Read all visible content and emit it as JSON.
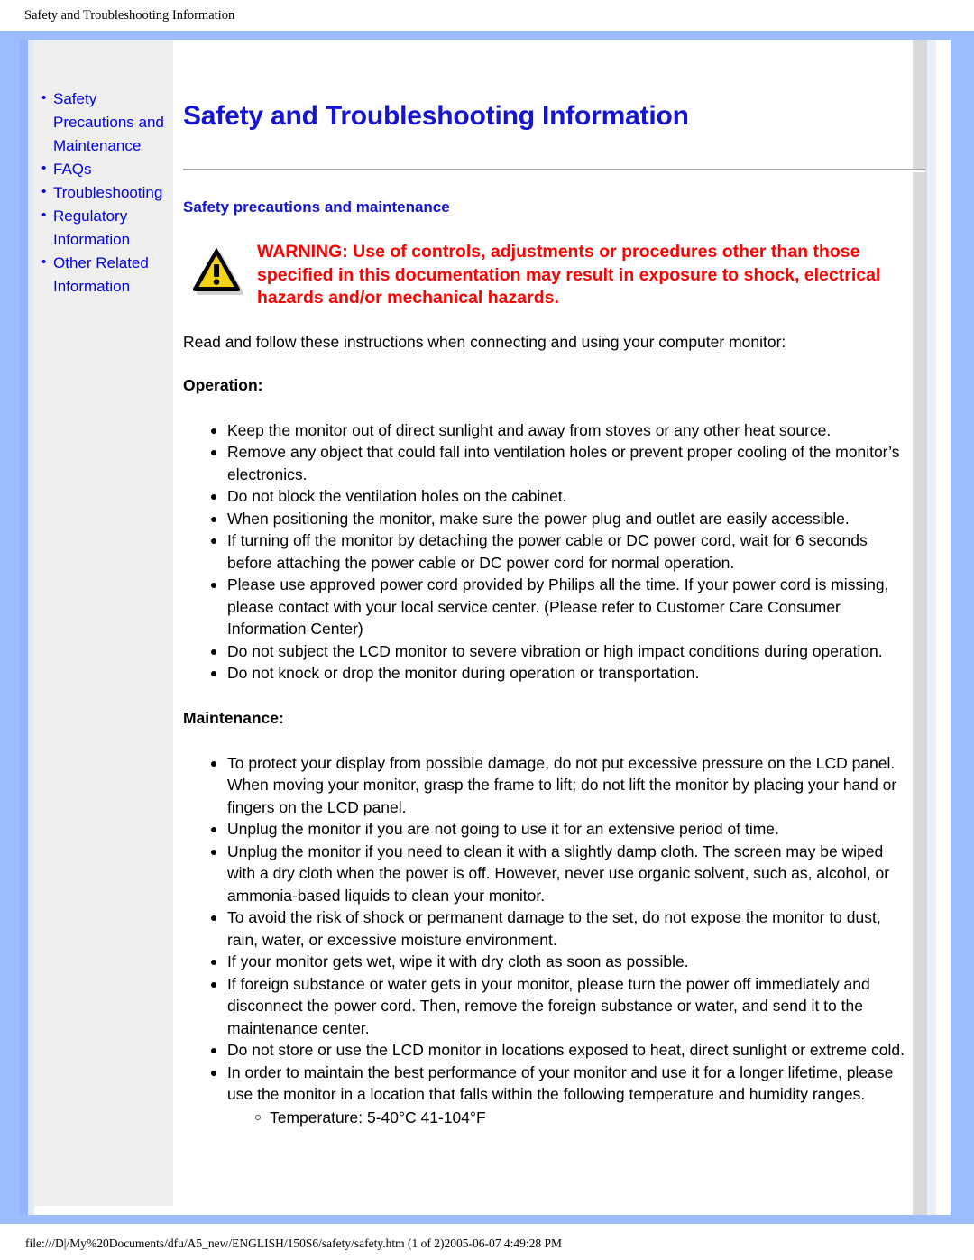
{
  "print_header": "Safety and Troubleshooting Information",
  "print_footer": "file:///D|/My%20Documents/dfu/A5_new/ENGLISH/150S6/safety/safety.htm (1 of 2)2005-06-07 4:49:28 PM",
  "colors": {
    "page_border": "#9dbcfb",
    "sidebar_bg": "#efefef",
    "link_blue": "#0000ee",
    "heading_blue": "#1414d2",
    "warning_red": "#ff0000",
    "warning_icon_fill": "#f5d312",
    "warning_icon_stroke": "#000000"
  },
  "sidebar": {
    "items": [
      {
        "label": "Safety Precautions and Maintenance"
      },
      {
        "label": "FAQs"
      },
      {
        "label": "Troubleshooting"
      },
      {
        "label": "Regulatory Information"
      },
      {
        "label": "Other Related Information"
      }
    ]
  },
  "main": {
    "title": "Safety and Troubleshooting Information",
    "section_heading": "Safety precautions and maintenance",
    "warning_icon_name": "warning-triangle-icon",
    "warning_text": "WARNING: Use of controls, adjustments or procedures other than those specified in this documentation may result in exposure to shock, electrical hazards and/or mechanical hazards.",
    "intro_paragraph": "Read and follow these instructions when connecting and using your computer monitor:",
    "operation": {
      "heading": "Operation:",
      "items": [
        "Keep the monitor out of direct sunlight and away from stoves or any other heat source.",
        "Remove any object that could fall into ventilation holes or prevent proper cooling of the monitor’s electronics.",
        "Do not block the ventilation holes on the cabinet.",
        "When positioning the monitor, make sure the power plug and outlet are easily accessible.",
        "If turning off the monitor by detaching the power cable or DC power cord, wait for 6 seconds before attaching the power cable or DC power cord for normal operation.",
        "Please use approved power cord provided by Philips all the time. If your power cord is missing, please contact with your local service center. (Please refer to Customer Care Consumer Information Center)",
        "Do not subject the LCD monitor to severe vibration or high impact conditions during operation.",
        "Do not knock or drop the monitor during operation or transportation."
      ]
    },
    "maintenance": {
      "heading": "Maintenance:",
      "items": [
        "To protect your display from possible damage, do not put excessive pressure on the LCD panel. When moving your monitor, grasp the frame to lift; do not lift the monitor by placing your hand or fingers on the LCD panel.",
        "Unplug the monitor if you are not going to use it for an extensive period of time.",
        "Unplug the monitor if you need to clean it with a slightly damp cloth. The screen may be wiped with a dry cloth when the power is off. However, never use organic solvent, such as, alcohol, or ammonia-based liquids to clean your monitor.",
        "To avoid the risk of shock or permanent damage to the set, do not expose the monitor to dust, rain, water, or excessive moisture environment.",
        "If your monitor gets wet, wipe it with dry cloth as soon as possible.",
        "If foreign substance or water gets in your monitor, please turn the power off immediately and disconnect the power cord. Then, remove the foreign substance or water, and send it to the maintenance center.",
        "Do not store or use the LCD monitor in locations exposed to heat, direct sunlight or extreme cold.",
        "In order to maintain the best performance of your monitor and use it for a longer lifetime, please use the monitor in a location that falls within the following temperature and humidity ranges."
      ],
      "sub_items": [
        "Temperature: 5-40°C 41-104°F"
      ]
    }
  }
}
